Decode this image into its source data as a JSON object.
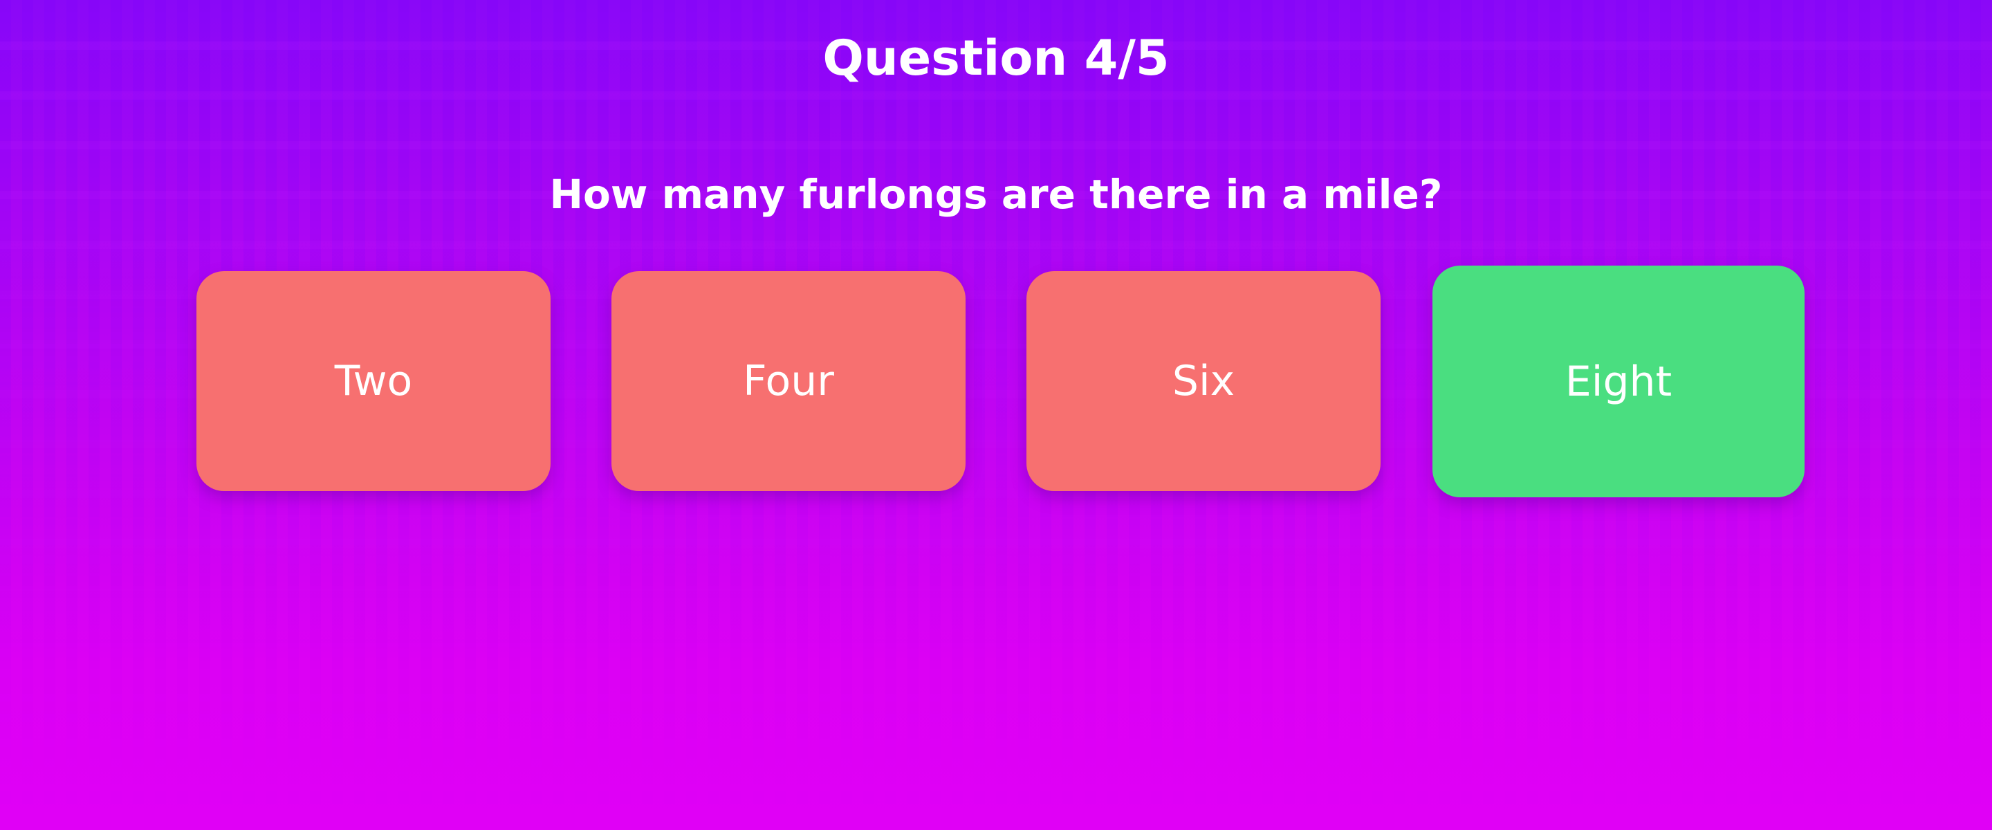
{
  "quiz": {
    "progress_label": "Question 4/5",
    "current_question": 4,
    "total_questions": 5,
    "question_text": "How many furlongs are there in a mile?",
    "answers": [
      {
        "label": "Two",
        "state": "incorrect",
        "color": "#f77070"
      },
      {
        "label": "Four",
        "state": "incorrect",
        "color": "#f77070"
      },
      {
        "label": "Six",
        "state": "incorrect",
        "color": "#f77070"
      },
      {
        "label": "Eight",
        "state": "correct",
        "color": "#4ade80"
      }
    ]
  },
  "theme": {
    "background_top": "#8a08f7",
    "background_bottom": "#e000f6",
    "text_color": "#ffffff"
  }
}
